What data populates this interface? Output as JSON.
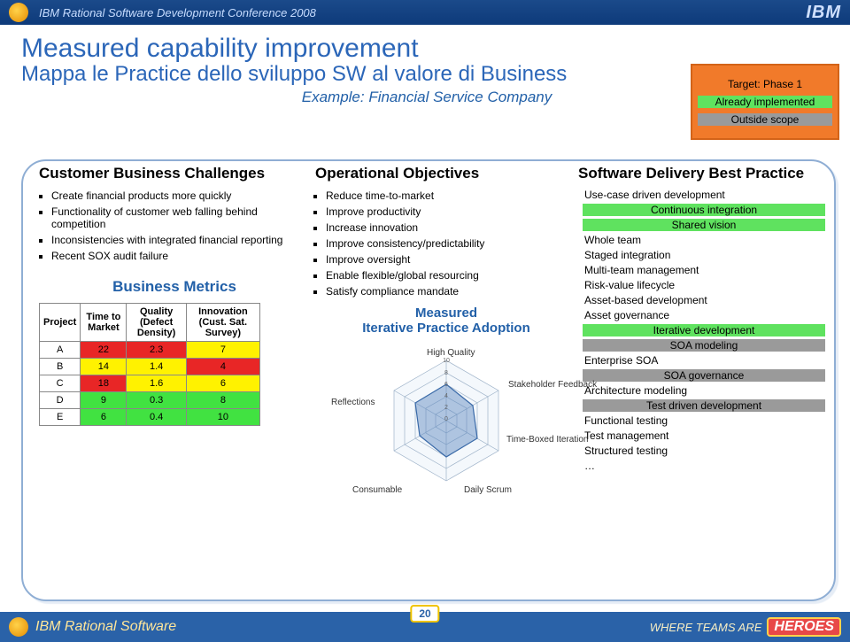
{
  "header": {
    "conference": "IBM Rational Software Development Conference 2008",
    "ibm": "IBM"
  },
  "titles": {
    "main": "Measured capability improvement",
    "sub": "Mappa le Practice dello sviluppo SW al valore di Business",
    "example": "Example: Financial Service Company"
  },
  "legend": {
    "target": "Target: Phase 1",
    "implemented": "Already implemented",
    "outside": "Outside scope"
  },
  "columns": {
    "h1": "Customer Business Challenges",
    "h2": "Operational Objectives",
    "h3": "Software Delivery Best Practice"
  },
  "challenges": [
    "Create financial products more quickly",
    "Functionality of customer web falling behind competition",
    "Inconsistencies with integrated financial reporting",
    "Recent SOX audit failure"
  ],
  "objectives": [
    "Reduce time-to-market",
    "Improve productivity",
    "Increase innovation",
    "Improve consistency/predictability",
    "Improve oversight",
    "Enable flexible/global resourcing",
    "Satisfy compliance mandate"
  ],
  "practices": [
    {
      "t": "Use-case driven development",
      "c": ""
    },
    {
      "t": "Continuous integration",
      "c": "imp"
    },
    {
      "t": "Shared vision",
      "c": "imp"
    },
    {
      "t": "Whole team",
      "c": ""
    },
    {
      "t": "Staged integration",
      "c": ""
    },
    {
      "t": "Multi-team management",
      "c": ""
    },
    {
      "t": "Risk-value lifecycle",
      "c": ""
    },
    {
      "t": "Asset-based development",
      "c": ""
    },
    {
      "t": "Asset governance",
      "c": ""
    },
    {
      "t": "Iterative development",
      "c": "imp"
    },
    {
      "t": "SOA modeling",
      "c": "out"
    },
    {
      "t": "Enterprise SOA",
      "c": ""
    },
    {
      "t": "SOA governance",
      "c": "out"
    },
    {
      "t": "Architecture modeling",
      "c": ""
    },
    {
      "t": "Test driven development",
      "c": "out"
    },
    {
      "t": "Functional testing",
      "c": ""
    },
    {
      "t": "Test management",
      "c": ""
    },
    {
      "t": "Structured testing",
      "c": ""
    },
    {
      "t": "…",
      "c": ""
    }
  ],
  "metrics": {
    "title": "Business Metrics",
    "headers": [
      "Project",
      "Time to Market",
      "Quality (Defect Density)",
      "Innovation (Cust. Sat. Survey)"
    ],
    "rows": [
      {
        "p": "A",
        "ttm": "22",
        "ttm_c": "hl-r",
        "q": "2.3",
        "q_c": "hl-r",
        "i": "7",
        "i_c": "hl-y"
      },
      {
        "p": "B",
        "ttm": "14",
        "ttm_c": "hl-y",
        "q": "1.4",
        "q_c": "hl-y",
        "i": "4",
        "i_c": "hl-r"
      },
      {
        "p": "C",
        "ttm": "18",
        "ttm_c": "hl-r",
        "q": "1.6",
        "q_c": "hl-y",
        "i": "6",
        "i_c": "hl-y"
      },
      {
        "p": "D",
        "ttm": "9",
        "ttm_c": "hl-g",
        "q": "0.3",
        "q_c": "hl-g",
        "i": "8",
        "i_c": "hl-g"
      },
      {
        "p": "E",
        "ttm": "6",
        "ttm_c": "hl-g",
        "q": "0.4",
        "q_c": "hl-g",
        "i": "10",
        "i_c": "hl-g"
      }
    ]
  },
  "radar": {
    "title1": "Measured",
    "title2": "Iterative Practice Adoption",
    "axes": [
      "High Quality",
      "Stakeholder Feedback",
      "Time-Boxed Iteration",
      "Daily Scrum",
      "Consumable",
      "Reflections"
    ],
    "ticks": [
      "10",
      "8",
      "6",
      "4",
      "2",
      "0"
    ]
  },
  "chart_data": {
    "type": "radar",
    "title": "Measured Iterative Practice Adoption",
    "axes": [
      "High Quality",
      "Stakeholder Feedback",
      "Time-Boxed Iteration",
      "Daily Scrum",
      "Consumable",
      "Reflections"
    ],
    "range": [
      0,
      10
    ],
    "values_estimated": [
      6,
      5,
      6,
      6,
      5,
      6
    ]
  },
  "footer": {
    "brand": "IBM Rational Software",
    "page": "20",
    "slogan": "WHERE TEAMS ARE",
    "heroes": "HEROES"
  }
}
